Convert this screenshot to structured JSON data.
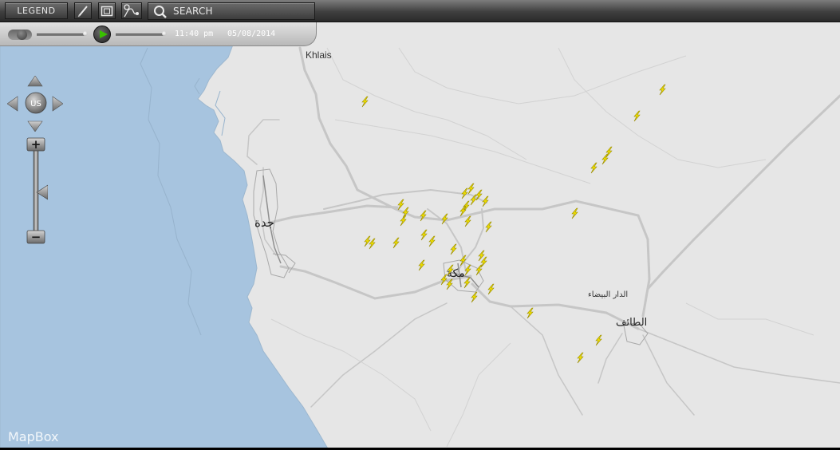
{
  "toolbar": {
    "legend_label": "LEGEND",
    "search_label": "SEARCH"
  },
  "timeline": {
    "time": "11:40 pm",
    "date": "05/08/2014"
  },
  "nav": {
    "center_label": "US"
  },
  "zoom": {
    "plus_label": "+",
    "minus_label": "−"
  },
  "map": {
    "attribution": "MapBox",
    "labels": {
      "khlais": "Khlais",
      "jeddah": "جدة",
      "makkah": "مكة",
      "dar_albaida": "الدار البيضاء",
      "taif": "الطائف"
    },
    "colors": {
      "land": "#e6e6e6",
      "sea": "#a7c4df",
      "road": "#c6c6c6",
      "lightning": "#f3e200"
    }
  }
}
